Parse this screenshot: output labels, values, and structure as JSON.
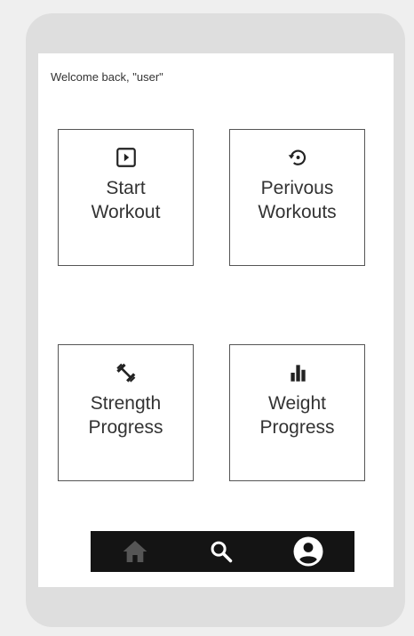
{
  "welcome_text": "Welcome back, \"user\"",
  "tiles": [
    {
      "line1": "Start",
      "line2": "Workout",
      "icon": "play-box-icon"
    },
    {
      "line1": "Perivous",
      "line2": "Workouts",
      "icon": "history-icon"
    },
    {
      "line1": "Strength",
      "line2": "Progress",
      "icon": "dumbbell-icon"
    },
    {
      "line1": "Weight",
      "line2": "Progress",
      "icon": "bar-chart-icon"
    }
  ],
  "navbar": {
    "items": [
      {
        "icon": "home-icon",
        "color": "#555555"
      },
      {
        "icon": "search-icon",
        "color": "#ffffff"
      },
      {
        "icon": "account-circle-icon",
        "color": "#ffffff"
      }
    ],
    "background": "#141414"
  }
}
